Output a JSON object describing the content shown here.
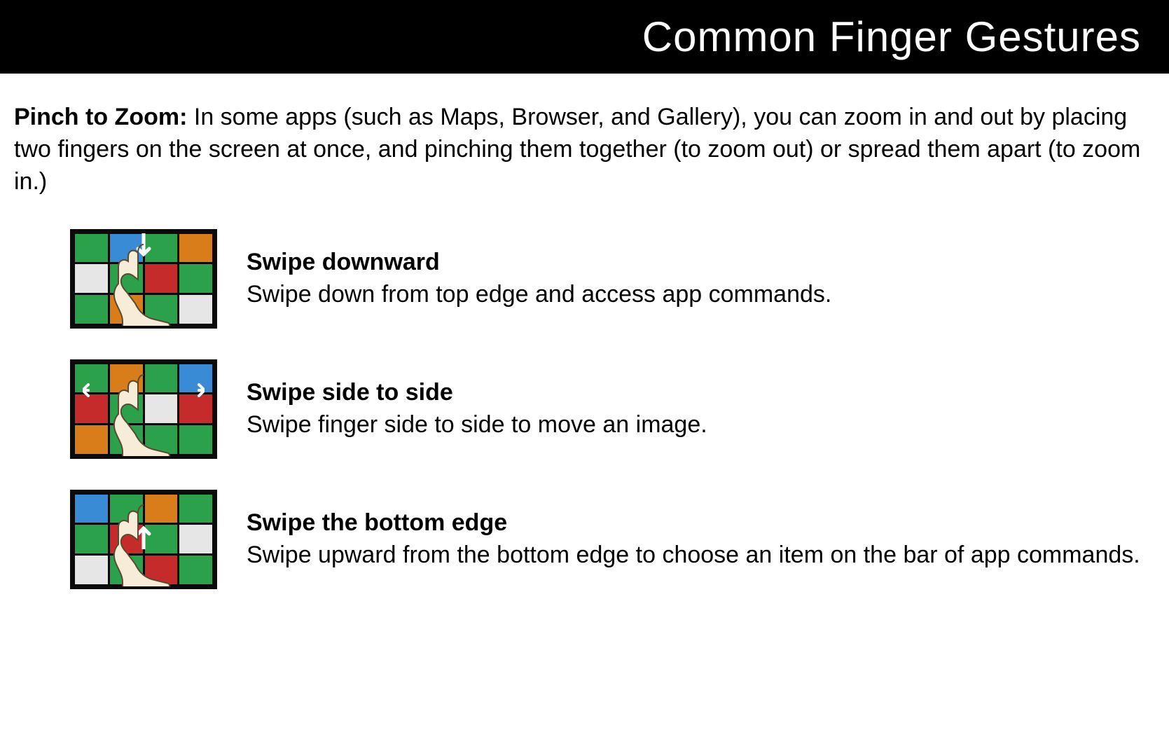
{
  "header": {
    "title": "Common Finger Gestures"
  },
  "intro": {
    "label": "Pinch to Zoom:",
    "text": " In some apps (such as Maps, Browser, and Gallery), you can zoom in and out by placing two fingers on the screen at once, and pinching them together (to zoom out) or spread them apart (to zoom in.)"
  },
  "gestures": [
    {
      "title": "Swipe downward",
      "description": "Swipe down from top edge and access app commands.",
      "icon": "swipe-down-icon"
    },
    {
      "title": "Swipe side to side",
      "description": "Swipe finger side to side to move an image.",
      "icon": "swipe-side-icon"
    },
    {
      "title": "Swipe the bottom edge",
      "description": "Swipe upward from the bottom edge to choose an item on the bar of app commands.",
      "icon": "swipe-up-icon"
    }
  ]
}
